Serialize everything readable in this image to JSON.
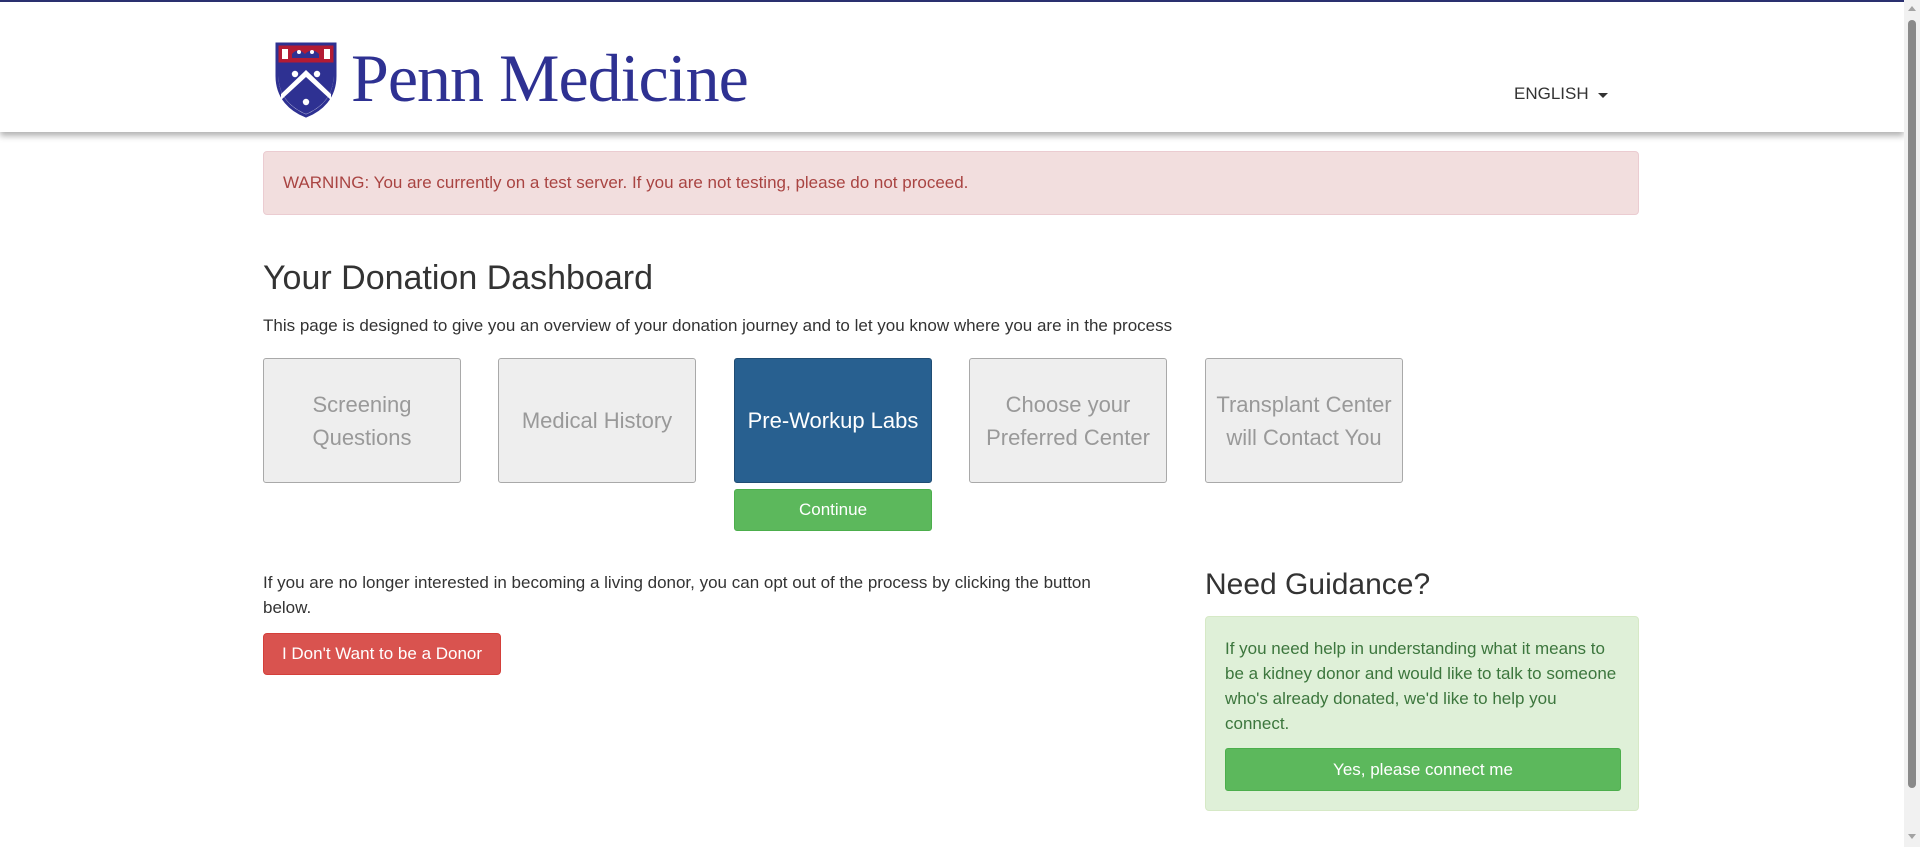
{
  "header": {
    "brand": "Penn Medicine",
    "language": "ENGLISH"
  },
  "alert": {
    "text": "WARNING: You are currently on a test server. If you are not testing, please do not proceed."
  },
  "dashboard": {
    "title": "Your Donation Dashboard",
    "subtitle": "This page is designed to give you an overview of your donation journey and to let you know where you are in the process",
    "steps": [
      {
        "label": "Screening Questions",
        "active": false
      },
      {
        "label": "Medical History",
        "active": false
      },
      {
        "label": "Pre-Workup Labs",
        "active": true
      },
      {
        "label": "Choose your Preferred Center",
        "active": false
      },
      {
        "label": "Transplant Center will Contact You",
        "active": false
      }
    ],
    "continue_label": "Continue"
  },
  "optout": {
    "text": "If you are no longer interested in becoming a living donor, you can opt out of the process by clicking the button below.",
    "button_label": "I Don't Want to be a Donor"
  },
  "guidance": {
    "title": "Need Guidance?",
    "text": "If you need help in understanding what it means to be a kidney donor and would like to talk to someone who's already donated, we'd like to help you connect.",
    "button_label": "Yes, please connect me"
  },
  "colors": {
    "brand_navy": "#2e3192",
    "shield_red": "#b31b34",
    "active_step": "#286090",
    "success": "#5cb85c",
    "danger": "#d9534f",
    "alert_bg": "#f2dede",
    "alert_text": "#a94442",
    "guidance_bg": "#dff0d8",
    "guidance_text": "#3c763d"
  }
}
